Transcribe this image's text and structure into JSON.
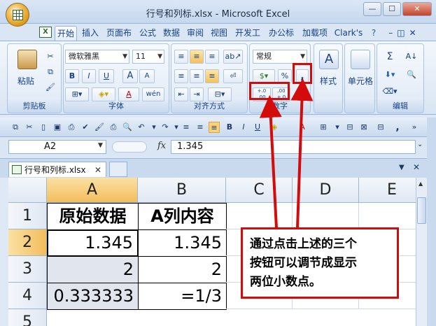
{
  "window": {
    "title": "行号和列标.xlsx - Microsoft Excel",
    "minimize_glyph": "—",
    "restore_glyph": "☐",
    "close_glyph": "✕"
  },
  "ribbon_tabs": [
    {
      "label": "开始",
      "active": true
    },
    {
      "label": "插入"
    },
    {
      "label": "页面布"
    },
    {
      "label": "公式"
    },
    {
      "label": "数据"
    },
    {
      "label": "审阅"
    },
    {
      "label": "视图"
    },
    {
      "label": "开发工"
    },
    {
      "label": "办公标"
    },
    {
      "label": "加载项"
    },
    {
      "label": "Clark's"
    }
  ],
  "ribbon": {
    "clipboard": {
      "paste_label": "粘贴",
      "group_label": "剪贴板"
    },
    "font": {
      "font_name": "微软雅黑",
      "font_size": "11",
      "bold": "B",
      "italic": "I",
      "underline": "U",
      "grow": "A",
      "shrink": "A",
      "font_color": "A",
      "phonetic": "wén",
      "group_label": "字体"
    },
    "alignment": {
      "group_label": "对齐方式"
    },
    "number": {
      "format": "常规",
      "percent": "%",
      "comma": ",",
      "increase_decimal": "+.0 .00",
      "decrease_decimal": ".00 +.0",
      "group_label": "数字"
    },
    "styles": {
      "label": "样式"
    },
    "cells": {
      "label": "单元格"
    },
    "editing": {
      "group_label": "编辑",
      "sum": "Σ"
    }
  },
  "toolbar2": {
    "bold": "B",
    "italic": "I",
    "underline": "U",
    "comma": ","
  },
  "formula_bar": {
    "name_box": "A2",
    "fx": "fx",
    "formula": "1.345"
  },
  "workbook_tab": {
    "label": "行号和列标.xlsx",
    "close": "✕"
  },
  "grid": {
    "columns": [
      "A",
      "B",
      "C",
      "D",
      "E"
    ],
    "rows": [
      "1",
      "2",
      "3",
      "4",
      "5"
    ],
    "cells": {
      "A1": "原始数据",
      "B1": "A列内容",
      "A2": "1.345",
      "B2": "1.345",
      "A3": "2",
      "B3": "2",
      "A4": "0.333333",
      "B4": "=1/3"
    }
  },
  "annotation": {
    "line1": "通过点击上述的三个",
    "line2": "按钮可以调节成显示",
    "line3": "两位小数点。",
    "color": "#d40b0b"
  }
}
